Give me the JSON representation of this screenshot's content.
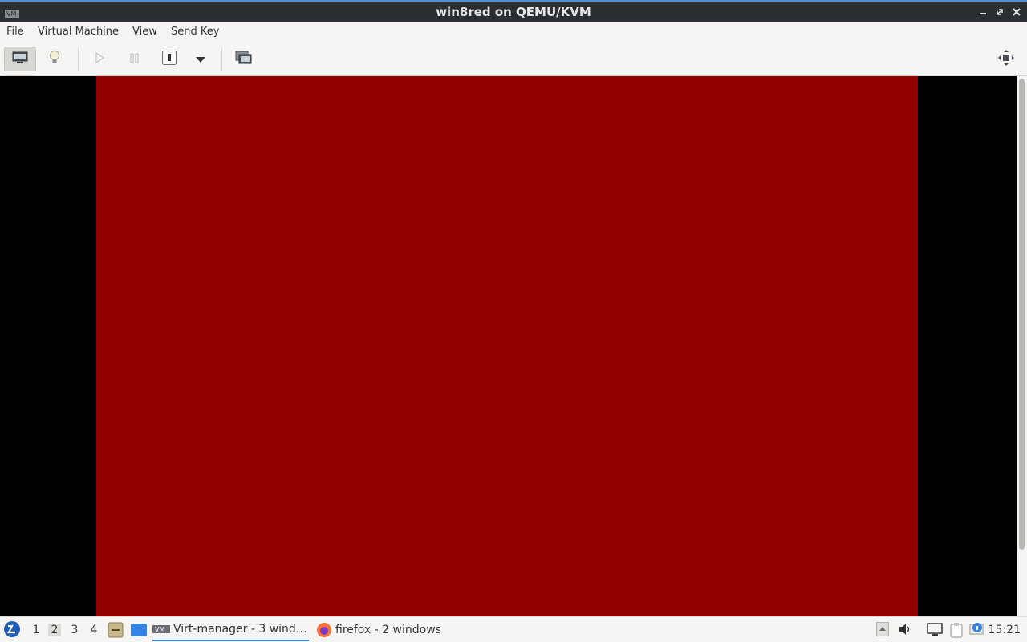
{
  "window": {
    "title": "win8red on QEMU/KVM"
  },
  "menubar": {
    "items": [
      "File",
      "Virtual Machine",
      "View",
      "Send Key"
    ]
  },
  "toolbar": {
    "buttons": [
      "console-view",
      "details-view",
      "run",
      "pause",
      "shutdown",
      "shutdown-menu",
      "snapshots",
      "fullscreen"
    ]
  },
  "guest_display": {
    "color": "#930000"
  },
  "taskbar": {
    "workspaces": [
      "1",
      "2",
      "3",
      "4"
    ],
    "active_workspace": "2",
    "tasks": [
      {
        "label": "Virt-manager - 3 wind…",
        "icon": "virt-manager-icon",
        "active": true
      },
      {
        "label": "firefox - 2 windows",
        "icon": "firefox-icon",
        "active": false
      }
    ],
    "clock": "15:21"
  }
}
